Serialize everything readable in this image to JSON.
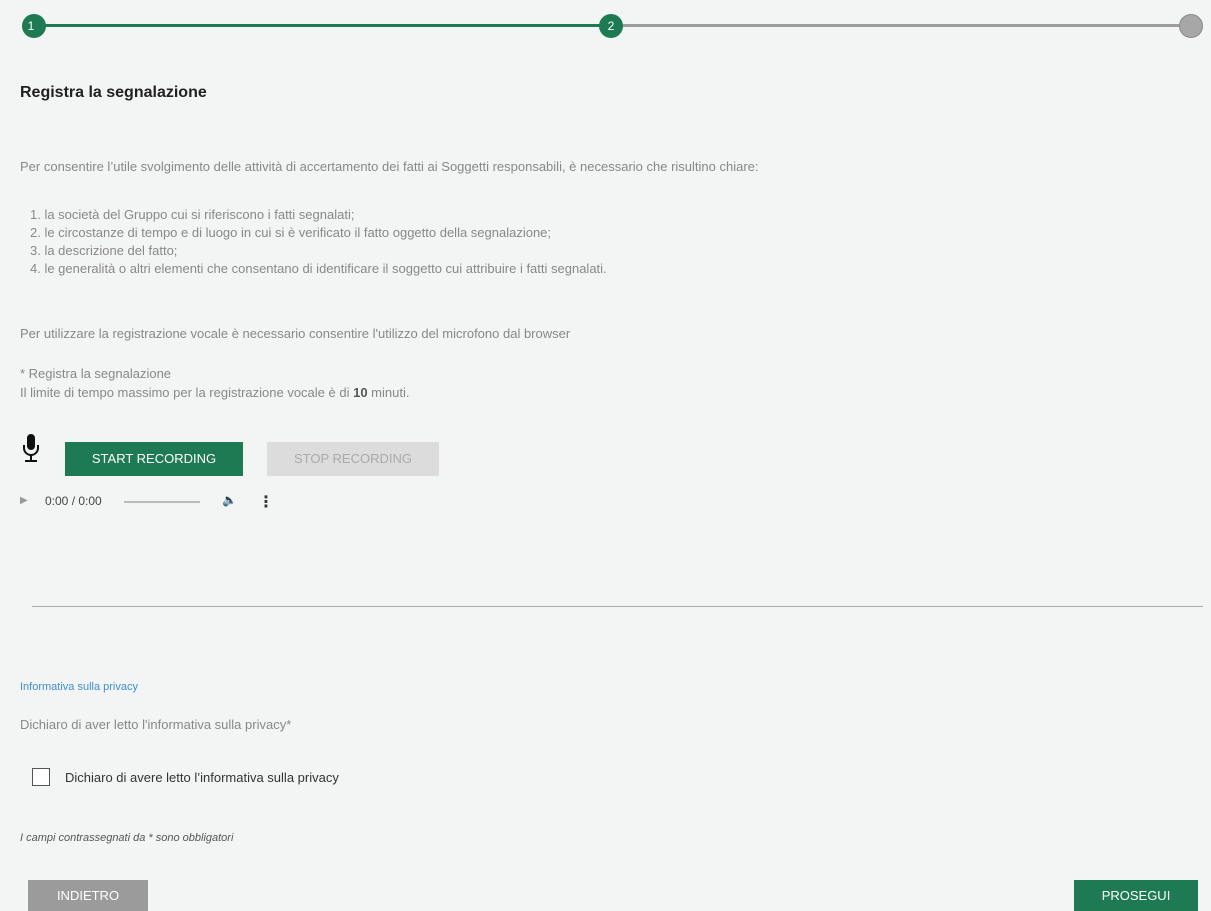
{
  "stepper": {
    "steps": [
      {
        "label": "1"
      },
      {
        "label": "2"
      },
      {
        "label": ""
      }
    ]
  },
  "page": {
    "title": "Registra la segnalazione",
    "intro": "Per consentire l’utile svolgimento delle attività di accertamento dei fatti ai Soggetti responsabili, è necessario che risultino chiare:",
    "list": [
      "1. la società del Gruppo cui si riferiscono i fatti segnalati;",
      "2. le circostanze di tempo e di luogo in cui si è verificato il fatto oggetto della segnalazione;",
      "3. la descrizione del fatto;",
      "4. le generalità o altri elementi che consentano di identificare il soggetto cui attribuire i fatti segnalati."
    ],
    "mic_note": "Per utilizzare la registrazione vocale è necessario consentire l'utilizzo del microfono dal browser",
    "required_label": "* Registra la segnalazione",
    "time_limit_prefix": "Il limite di tempo massimo per la registrazione vocale è di ",
    "time_limit_value": "10",
    "time_limit_suffix": " minuti."
  },
  "recorder": {
    "mic_icon": "microphone-icon",
    "start_label": "START RECORDING",
    "stop_label": "STOP RECORDING",
    "audio_time": "0:00 / 0:00"
  },
  "privacy": {
    "link": "Informativa sulla privacy",
    "declare_label": "Dichiaro di aver letto l'informativa sulla privacy*",
    "checkbox_label": "Dichiaro di avere letto l’informativa sulla privacy",
    "checked": false
  },
  "footer": {
    "required_note": "I campi contrassegnati da * sono obbligatori",
    "back_label": "INDIETRO",
    "next_label": "PROSEGUI"
  },
  "colors": {
    "accent": "#1e7a52",
    "disabled": "#dcdcdc",
    "link": "#3f8fd1"
  }
}
